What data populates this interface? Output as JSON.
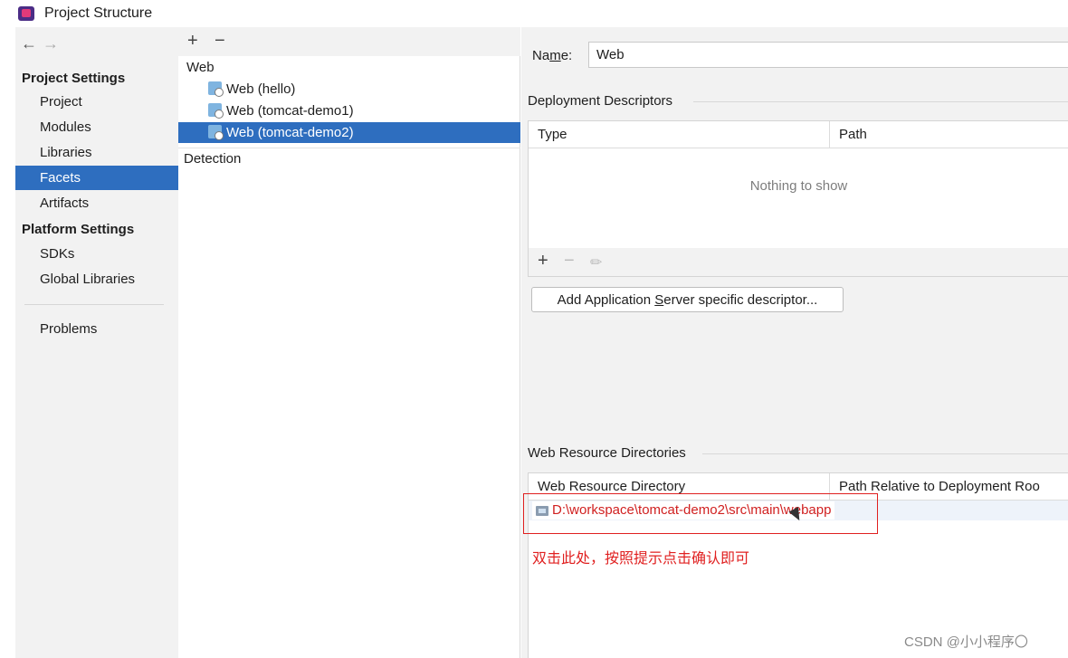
{
  "window": {
    "title": "Project Structure"
  },
  "nav": {
    "back": "←",
    "forward": "→"
  },
  "sidebar": {
    "project_settings_header": "Project Settings",
    "project_items": [
      "Project",
      "Modules",
      "Libraries",
      "Facets",
      "Artifacts"
    ],
    "selected_item": "Facets",
    "platform_settings_header": "Platform Settings",
    "platform_items": [
      "SDKs",
      "Global Libraries"
    ],
    "problems": "Problems"
  },
  "facets_tree": {
    "toolbar": {
      "add": "+",
      "remove": "−"
    },
    "root": "Web",
    "items": [
      "Web (hello)",
      "Web (tomcat-demo1)",
      "Web (tomcat-demo2)"
    ],
    "selected_item": "Web (tomcat-demo2)",
    "detection": "Detection"
  },
  "facet_editor": {
    "name_label_pre": "Na",
    "name_label_mnemonic": "m",
    "name_label_post": "e:",
    "name_value": "Web",
    "deployment_descriptors": {
      "title": "Deployment Descriptors",
      "columns": [
        "Type",
        "Path"
      ],
      "empty_text": "Nothing to show",
      "toolbar": {
        "add": "+",
        "remove": "−",
        "edit": "✏"
      },
      "add_button_pre": "Add Application ",
      "add_button_mnemonic": "S",
      "add_button_post": "erver specific descriptor..."
    },
    "web_resource_directories": {
      "title": "Web Resource Directories",
      "columns": [
        "Web Resource Directory",
        "Path Relative to Deployment Roo"
      ],
      "rows": [
        {
          "directory": "D:\\workspace\\tomcat-demo2\\src\\main\\webapp",
          "relative_path": ""
        }
      ]
    }
  },
  "annotation": {
    "text": "双击此处，按照提示点击确认即可",
    "color": "#e02020"
  },
  "watermark": "CSDN @小小程序〇",
  "colors": {
    "selection": "#2e6ebf",
    "panel_bg": "#f2f2f2",
    "annotation_red": "#e02020"
  }
}
